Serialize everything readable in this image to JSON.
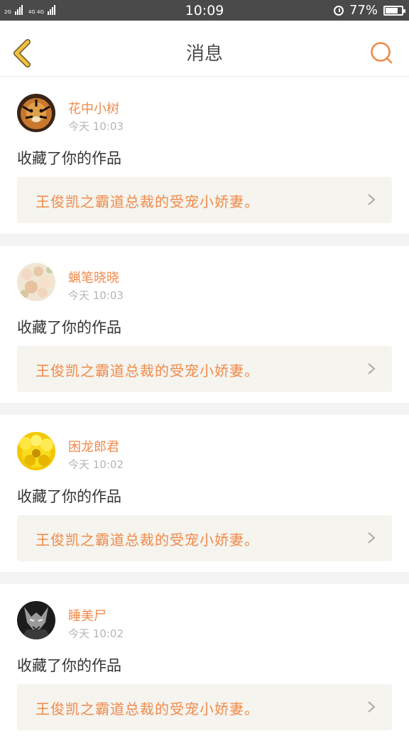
{
  "status_bar": {
    "net_left": "2G",
    "net_right": "4G 4G",
    "time": "10:09",
    "battery": "77%",
    "battery_level": 0.77
  },
  "header": {
    "title": "消息",
    "back_icon": "chevron-left-icon",
    "search_icon": "search-icon"
  },
  "colors": {
    "accent": "#f08a4b",
    "back_icon": "#f0c040",
    "card_bg": "#f5f4ee"
  },
  "messages": [
    {
      "username": "花中小树",
      "time": "今天 10:03",
      "action": "收藏了你的作品",
      "work_title": "王俊凯之霸道总裁的受宠小娇妻。",
      "avatar": "tiger-avatar"
    },
    {
      "username": "蝋笔晓晓",
      "time": "今天 10:03",
      "action": "收藏了你的作品",
      "work_title": "王俊凯之霸道总裁的受宠小娇妻。",
      "avatar": "flowers-avatar"
    },
    {
      "username": "困龙郎君",
      "time": "今天 10:02",
      "action": "收藏了你的作品",
      "work_title": "王俊凯之霸道总裁的受宠小娇妻。",
      "avatar": "sunflower-avatar"
    },
    {
      "username": "睡美尸",
      "time": "今天 10:02",
      "action": "收藏了你的作品",
      "work_title": "王俊凯之霸道总裁的受宠小娇妻。",
      "avatar": "dark-figure-avatar"
    }
  ]
}
